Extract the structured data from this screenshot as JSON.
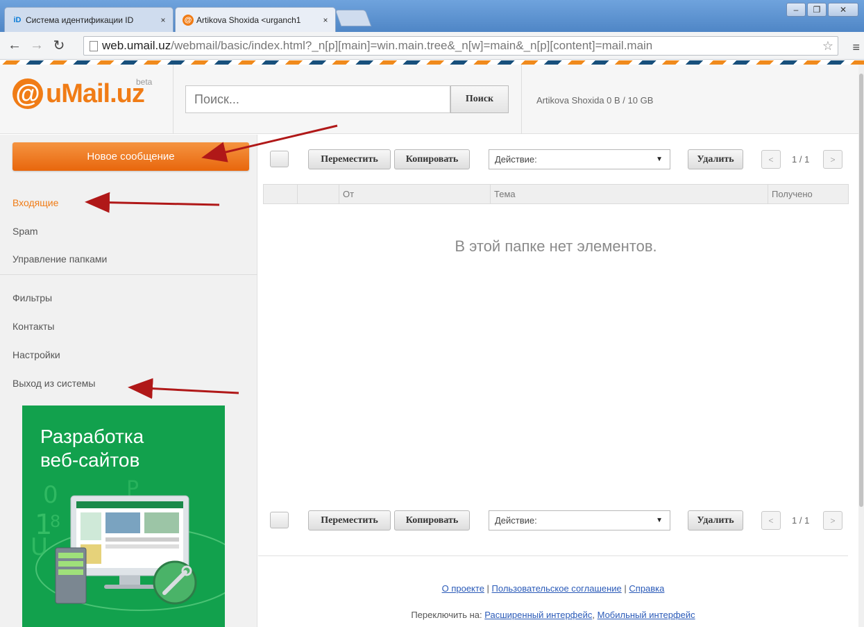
{
  "browser": {
    "tabs": [
      {
        "title": "Система идентификации ID",
        "favicon": "iD"
      },
      {
        "title": "Artikova Shoxida <urganch1",
        "favicon": "@"
      }
    ],
    "url_host": "web.umail.uz",
    "url_path": "/webmail/basic/index.html?_n[p][main]=win.main.tree&_n[w]=main&_n[p][content]=mail.main",
    "close_glyph": "×",
    "icons": [
      "back-arrow-icon",
      "forward-arrow-icon",
      "reload-icon",
      "page-icon",
      "star-icon",
      "menu-icon"
    ]
  },
  "header": {
    "logo_symbol": "@",
    "logo_text": "uMail.uz",
    "logo_beta": "beta",
    "search_placeholder": "Поиск...",
    "search_button": "Поиск",
    "user_info": "Artikova Shoxida 0 B / 10 GB"
  },
  "sidebar": {
    "compose": "Новое сообщение",
    "folders": [
      "Входящие",
      "Spam",
      "Управление папками"
    ],
    "tools": [
      "Фильтры",
      "Контакты",
      "Настройки",
      "Выход из системы"
    ],
    "ad_title_line1": "Разработка",
    "ad_title_line2": "веб-сайтов"
  },
  "toolbar": {
    "move": "Переместить",
    "copy": "Копировать",
    "action_select": "Действие:",
    "delete": "Удалить",
    "prev": "<",
    "next": ">",
    "page": "1 / 1"
  },
  "table": {
    "col_from": "От",
    "col_subject": "Тема",
    "col_received": "Получено",
    "empty_message": "В этой папке нет элементов."
  },
  "footer": {
    "about": "О проекте",
    "agreement": "Пользовательское соглашение",
    "help": "Справка",
    "switch_label": "Переключить на:",
    "advanced": "Расширенный интерфейс",
    "mobile": "Мобильный интерфейс"
  },
  "colors": {
    "accent": "#f07c16",
    "ad_green": "#12a14d",
    "link": "#2a5ab8",
    "arrow": "#b01818"
  }
}
